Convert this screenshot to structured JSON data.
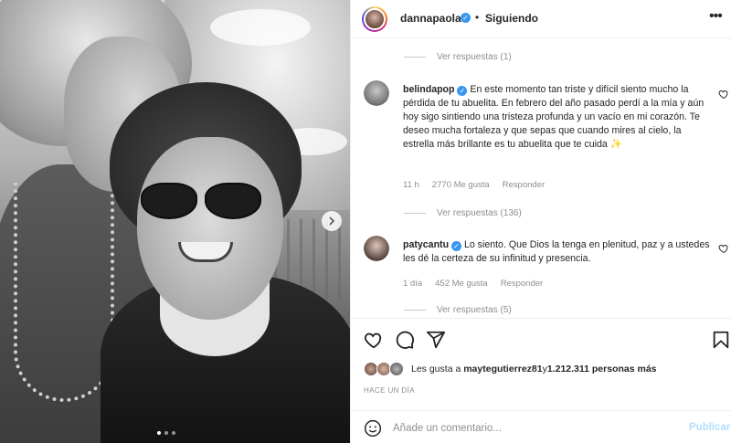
{
  "header": {
    "username": "dannapaola",
    "separator": "•",
    "follow_label": "Siguiendo",
    "more": "•••"
  },
  "photo": {
    "carousel_count": 3,
    "active_index": 0
  },
  "view_replies": [
    "Ver respuestas (1)",
    "Ver respuestas (136)",
    "Ver respuestas (5)"
  ],
  "comments": [
    {
      "username": "belindapop",
      "text": "En este momento tan triste y difícil siento mucho la pérdida de tu abuelita. En febrero del año pasado perdí a la mía y aún hoy sigo sintiendo una tristeza profunda y un vacío en mi corazón. Te deseo mucha fortaleza y que sepas que cuando mires al cielo, la estrella más brillante es tu abuelita que te cuida ✨",
      "time": "11 h",
      "likes": "2770 Me gusta",
      "reply": "Responder"
    },
    {
      "username": "patycantu",
      "text": "Lo siento. Que Dios la tenga en plenitud, paz y a ustedes les dé la certeza de su infinitud y presencia.",
      "time": "1 día",
      "likes": "452 Me gusta",
      "reply": "Responder"
    }
  ],
  "likes": {
    "prefix": "Les gusta a ",
    "user": "maytegutierrez81",
    "middle": " y ",
    "count": "1.212.311 personas más"
  },
  "timeago": "HACE UN DÍA",
  "add_comment": {
    "placeholder": "Añade un comentario...",
    "post_label": "Publicar"
  },
  "colors": {
    "verified": "#3897f0",
    "muted": "#8e8e8e",
    "post_disabled": "#b2dffc"
  },
  "icons": [
    "chevron-right-icon",
    "heart-icon",
    "comment-icon",
    "share-icon",
    "bookmark-icon",
    "emoji-icon",
    "verified-icon",
    "more-icon"
  ]
}
